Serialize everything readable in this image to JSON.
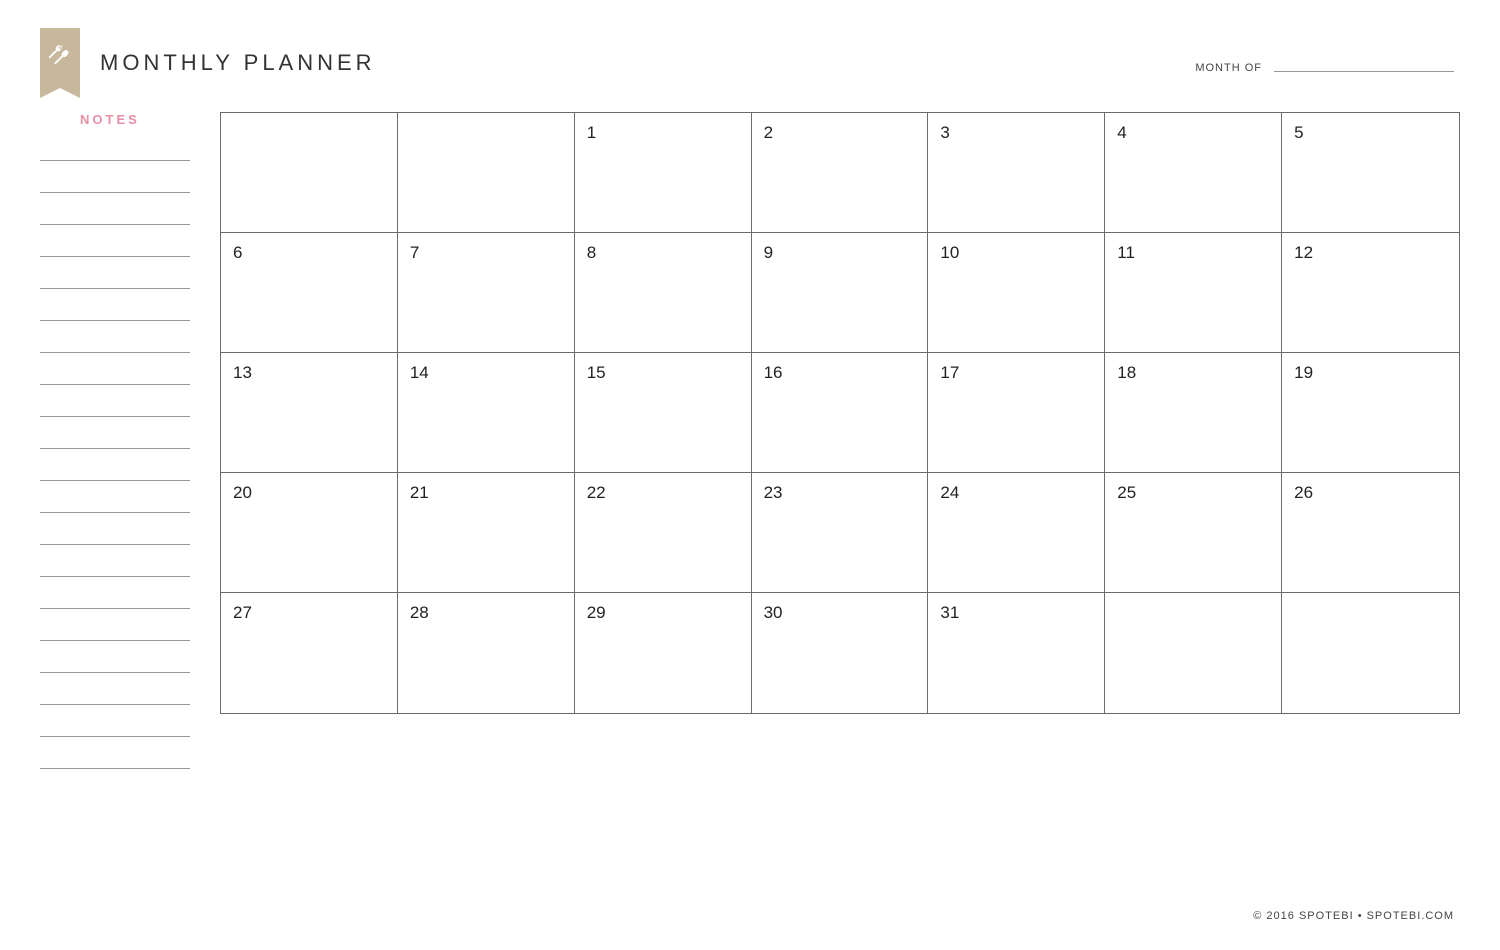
{
  "header": {
    "title": "MONTHLY PLANNER",
    "month_label": "MONTH OF",
    "month_value": ""
  },
  "notes": {
    "heading": "NOTES",
    "line_count": 20
  },
  "calendar": {
    "rows": [
      [
        "",
        "",
        "1",
        "2",
        "3",
        "4",
        "5"
      ],
      [
        "6",
        "7",
        "8",
        "9",
        "10",
        "11",
        "12"
      ],
      [
        "13",
        "14",
        "15",
        "16",
        "17",
        "18",
        "19"
      ],
      [
        "20",
        "21",
        "22",
        "23",
        "24",
        "25",
        "26"
      ],
      [
        "27",
        "28",
        "29",
        "30",
        "31",
        "",
        ""
      ]
    ]
  },
  "footer": {
    "text": "© 2016 SPOTEBI • SPOTEBI.COM"
  }
}
